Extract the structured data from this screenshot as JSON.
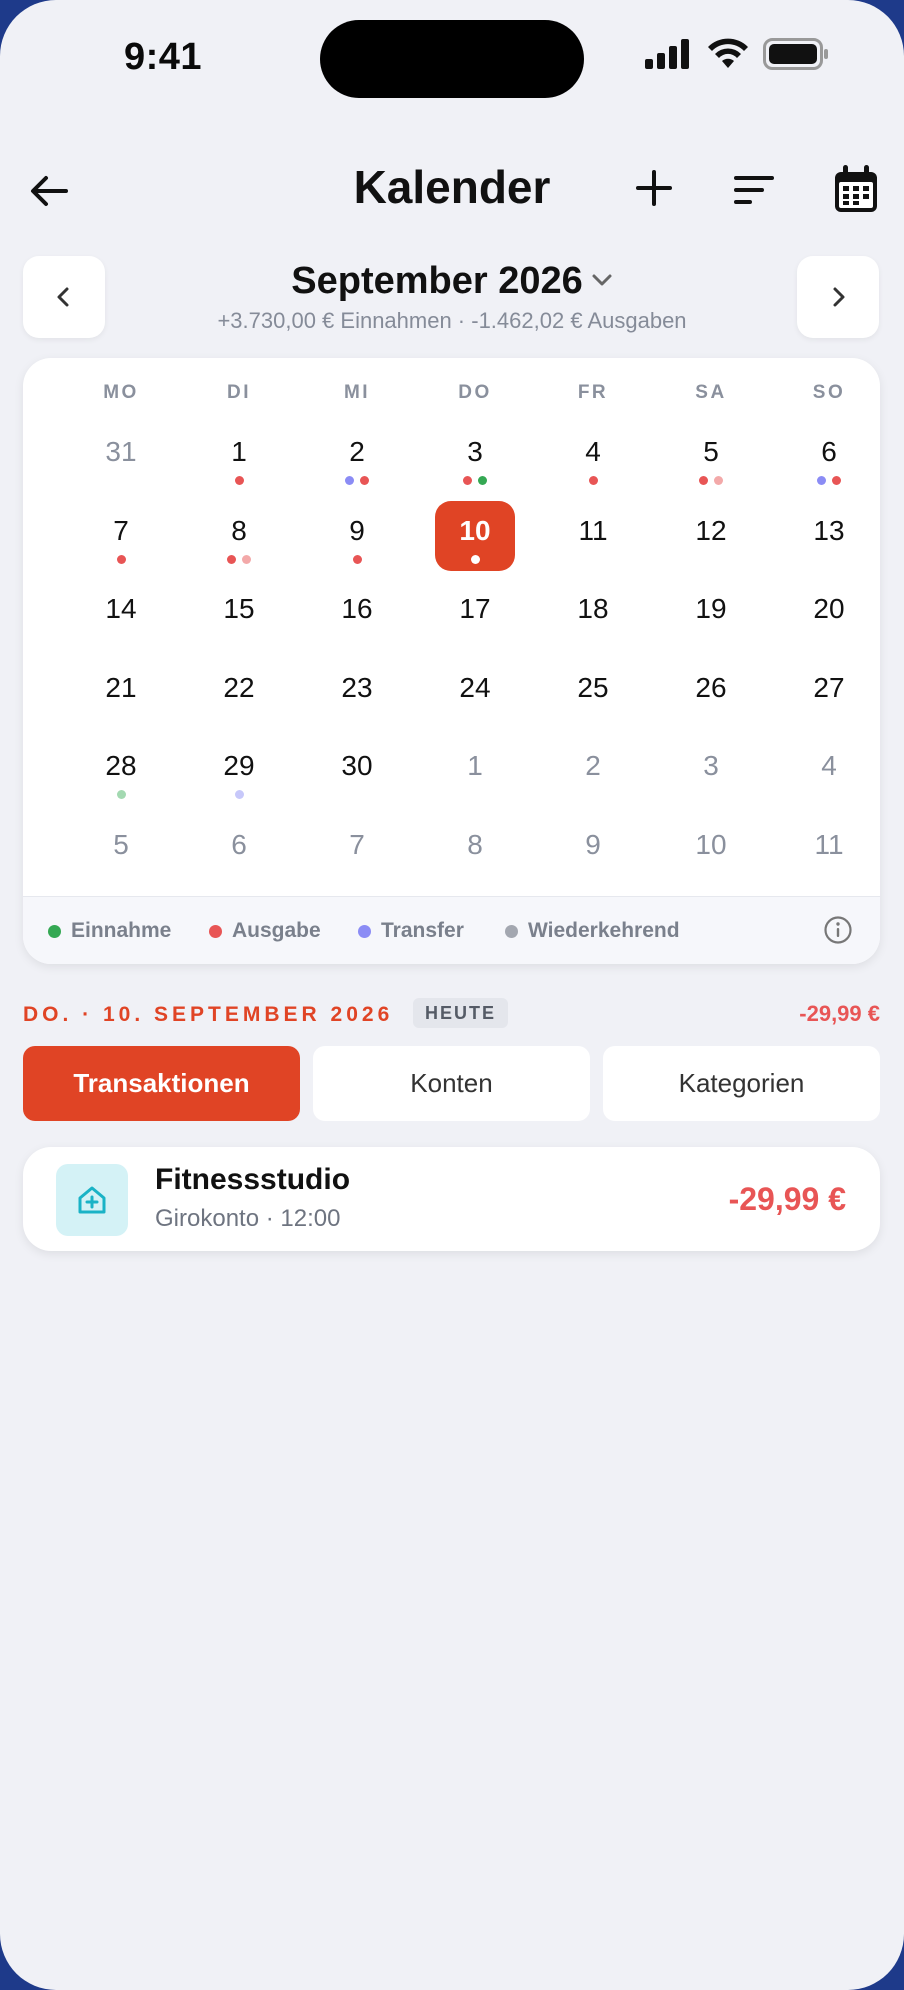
{
  "status": {
    "time": "9:41"
  },
  "nav": {
    "title": "Kalender"
  },
  "month": {
    "title": "September 2026",
    "summary": "+3.730,00 € Einnahmen · -1.462,02 € Ausgaben"
  },
  "weekdays": [
    "MO",
    "DI",
    "MI",
    "DO",
    "FR",
    "SA",
    "SO"
  ],
  "colors": {
    "accent": "#e04425",
    "income": "#34a853",
    "expense": "#e85555",
    "expense_light": "#f3a9a9",
    "transfer": "#8b8cf5",
    "transfer_light": "#c7c8fa",
    "income_light": "#a3d9b1",
    "recurring": "#a3a7b0"
  },
  "calendar": {
    "days": [
      {
        "d": "31",
        "other": true,
        "dots": []
      },
      {
        "d": "1",
        "dots": [
          "expense"
        ]
      },
      {
        "d": "2",
        "dots": [
          "transfer",
          "expense"
        ]
      },
      {
        "d": "3",
        "dots": [
          "expense",
          "income"
        ]
      },
      {
        "d": "4",
        "dots": [
          "expense"
        ]
      },
      {
        "d": "5",
        "dots": [
          "expense",
          "expense_light"
        ]
      },
      {
        "d": "6",
        "dots": [
          "transfer",
          "expense"
        ]
      },
      {
        "d": "7",
        "dots": [
          "expense"
        ]
      },
      {
        "d": "8",
        "dots": [
          "expense",
          "expense_light"
        ]
      },
      {
        "d": "9",
        "dots": [
          "expense"
        ]
      },
      {
        "d": "10",
        "today": true,
        "dots": [
          "white"
        ]
      },
      {
        "d": "11",
        "dots": []
      },
      {
        "d": "12",
        "dots": []
      },
      {
        "d": "13",
        "dots": []
      },
      {
        "d": "14",
        "dots": []
      },
      {
        "d": "15",
        "dots": []
      },
      {
        "d": "16",
        "dots": []
      },
      {
        "d": "17",
        "dots": []
      },
      {
        "d": "18",
        "dots": []
      },
      {
        "d": "19",
        "dots": []
      },
      {
        "d": "20",
        "dots": []
      },
      {
        "d": "21",
        "dots": []
      },
      {
        "d": "22",
        "dots": []
      },
      {
        "d": "23",
        "dots": []
      },
      {
        "d": "24",
        "dots": []
      },
      {
        "d": "25",
        "dots": []
      },
      {
        "d": "26",
        "dots": []
      },
      {
        "d": "27",
        "dots": []
      },
      {
        "d": "28",
        "dots": [
          "income_light"
        ]
      },
      {
        "d": "29",
        "dots": [
          "transfer_light"
        ]
      },
      {
        "d": "30",
        "dots": []
      },
      {
        "d": "1",
        "other": true,
        "dots": []
      },
      {
        "d": "2",
        "other": true,
        "dots": []
      },
      {
        "d": "3",
        "other": true,
        "dots": []
      },
      {
        "d": "4",
        "other": true,
        "dots": []
      },
      {
        "d": "5",
        "other": true,
        "dots": []
      },
      {
        "d": "6",
        "other": true,
        "dots": []
      },
      {
        "d": "7",
        "other": true,
        "dots": []
      },
      {
        "d": "8",
        "other": true,
        "dots": []
      },
      {
        "d": "9",
        "other": true,
        "dots": []
      },
      {
        "d": "10",
        "other": true,
        "dots": []
      },
      {
        "d": "11",
        "other": true,
        "dots": []
      }
    ]
  },
  "legend": {
    "income": "Einnahme",
    "expense": "Ausgabe",
    "transfer": "Transfer",
    "recurring": "Wiederkehrend"
  },
  "selected_day": {
    "label": "DO. · 10. SEPTEMBER 2026",
    "badge": "HEUTE",
    "total": "-29,99 €"
  },
  "tabs": [
    "Transaktionen",
    "Konten",
    "Kategorien"
  ],
  "transactions": [
    {
      "name": "Fitnessstudio",
      "meta": "Girokonto · 12:00",
      "amount": "-29,99 €",
      "icon": "health-house-icon"
    }
  ]
}
